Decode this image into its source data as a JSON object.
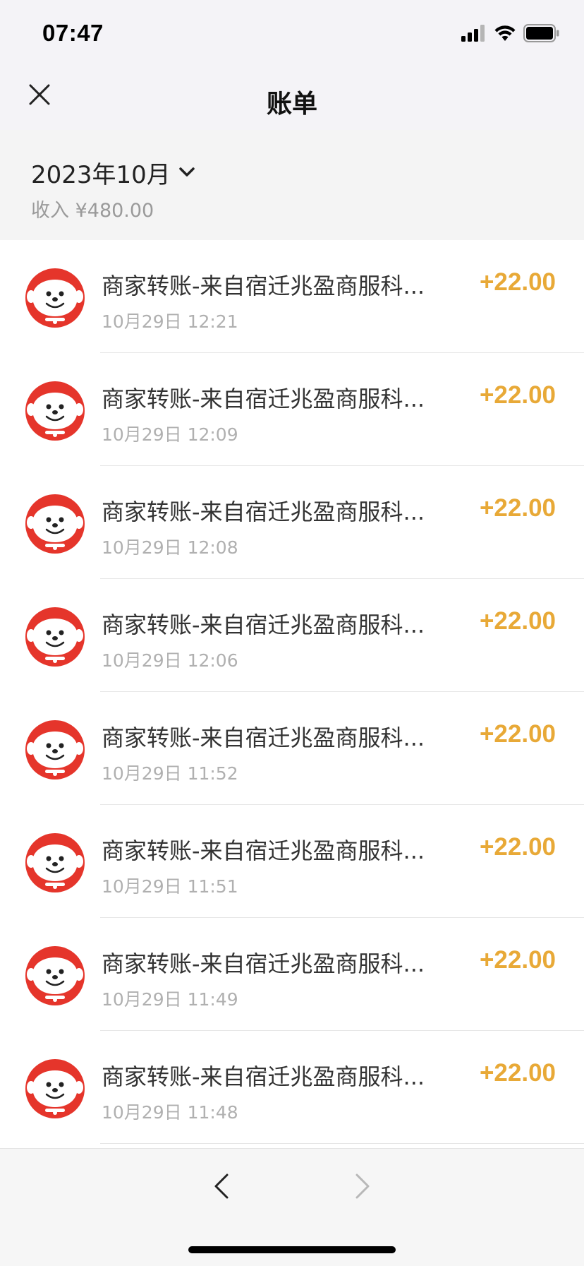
{
  "status_bar": {
    "time": "07:47",
    "icons": [
      "signal-icon",
      "wifi-icon",
      "battery-icon"
    ]
  },
  "nav": {
    "title": "账单",
    "close_icon": "close-icon"
  },
  "month": {
    "label": "2023年10月",
    "dropdown_icon": "chevron-down-icon",
    "income_summary": "收入 ¥480.00"
  },
  "colors": {
    "amount": "#e8a937",
    "avatar_bg": "#e5352b"
  },
  "transactions": [
    {
      "title": "商家转账-来自宿迁兆盈商服科...",
      "time": "10月29日 12:21",
      "amount": "+22.00"
    },
    {
      "title": "商家转账-来自宿迁兆盈商服科...",
      "time": "10月29日 12:09",
      "amount": "+22.00"
    },
    {
      "title": "商家转账-来自宿迁兆盈商服科...",
      "time": "10月29日 12:08",
      "amount": "+22.00"
    },
    {
      "title": "商家转账-来自宿迁兆盈商服科...",
      "time": "10月29日 12:06",
      "amount": "+22.00"
    },
    {
      "title": "商家转账-来自宿迁兆盈商服科...",
      "time": "10月29日 11:52",
      "amount": "+22.00"
    },
    {
      "title": "商家转账-来自宿迁兆盈商服科...",
      "time": "10月29日 11:51",
      "amount": "+22.00"
    },
    {
      "title": "商家转账-来自宿迁兆盈商服科...",
      "time": "10月29日 11:49",
      "amount": "+22.00"
    },
    {
      "title": "商家转账-来自宿迁兆盈商服科...",
      "time": "10月29日 11:48",
      "amount": "+22.00"
    }
  ],
  "bottom_bar": {
    "back_icon": "chevron-left-icon",
    "forward_icon": "chevron-right-icon"
  }
}
